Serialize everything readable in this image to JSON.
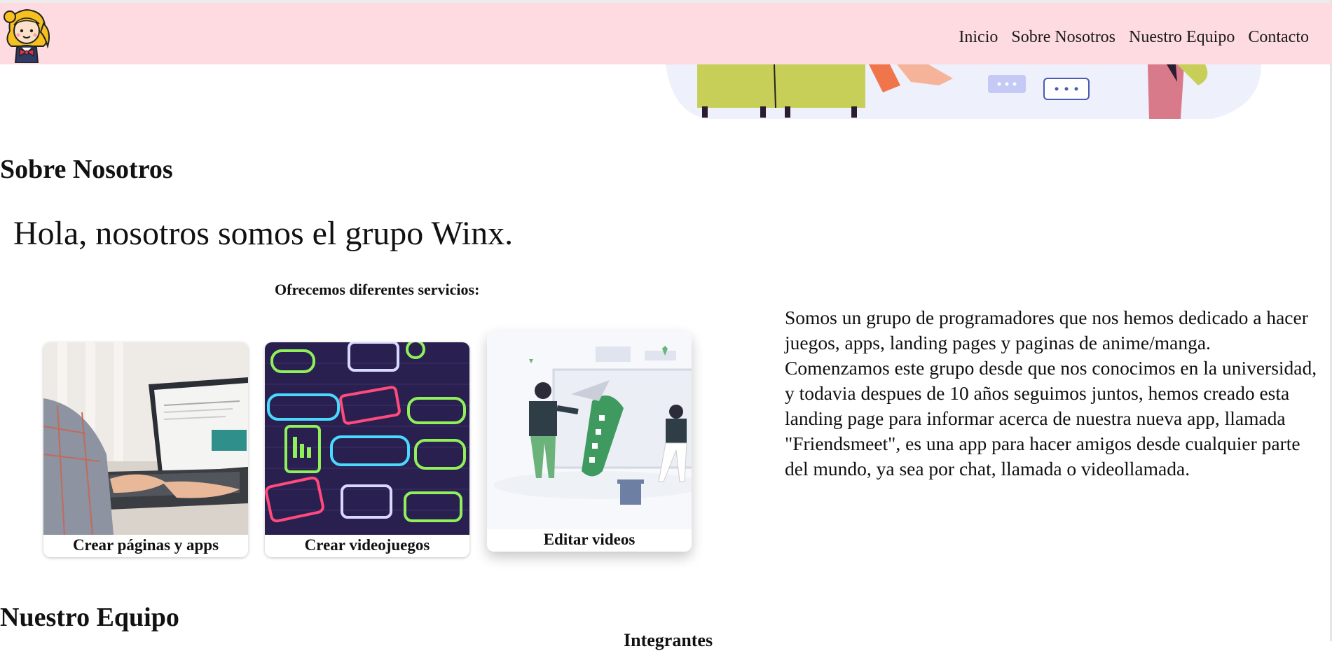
{
  "nav": {
    "links": [
      "Inicio",
      "Sobre Nosotros",
      "Nuestro Equipo",
      "Contacto"
    ]
  },
  "about": {
    "heading": "Sobre Nosotros",
    "greeting": "Hola, nosotros somos el grupo Winx.",
    "services_caption": "Ofrecemos diferentes servicios:",
    "services": [
      {
        "label": "Crear páginas y apps"
      },
      {
        "label": "Crear videojuegos"
      },
      {
        "label": "Editar videos"
      }
    ],
    "description": "Somos un grupo de programadores que nos hemos dedicado a hacer juegos, apps, landing pages y paginas de anime/manga. Comenzamos este grupo desde que nos conocimos en la universidad, y todavia despues de 10 años seguimos juntos, hemos creado esta landing page para informar acerca de nuestra nueva app, llamada \"Friendsmeet\", es una app para hacer amigos desde cualquier parte del mundo, ya sea por chat, llamada o videollamada."
  },
  "team": {
    "heading": "Nuestro Equipo",
    "subheading": "Integrantes"
  },
  "colors": {
    "navbar_bg": "#fddbe0",
    "page_bg": "#ffffff"
  }
}
